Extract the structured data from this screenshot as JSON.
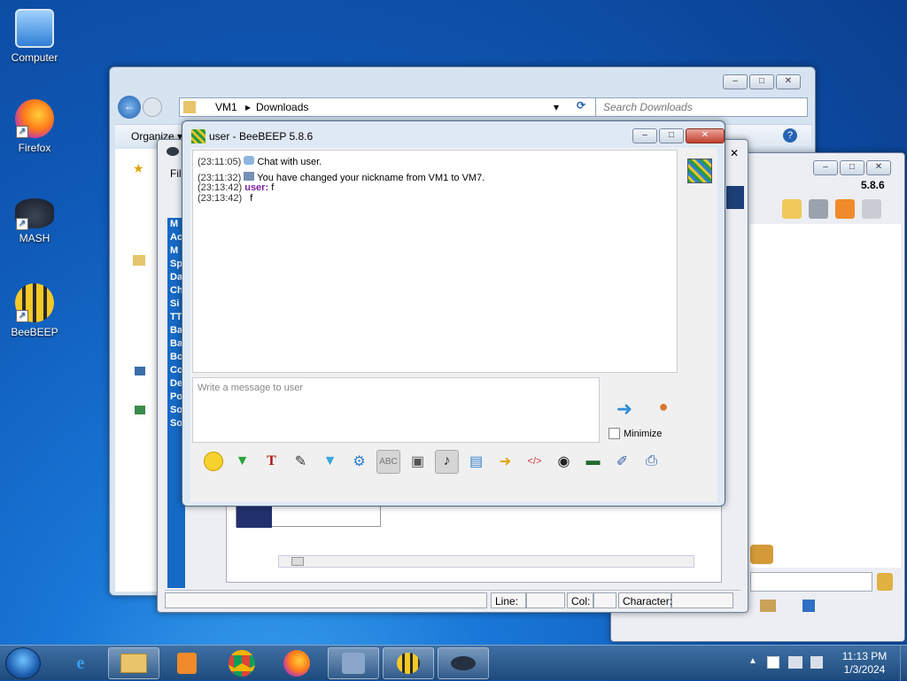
{
  "desktop": {
    "icons": [
      {
        "label": "Computer",
        "icon": "computer-icon"
      },
      {
        "label": "Firefox",
        "icon": "firefox-icon"
      },
      {
        "label": "MASH",
        "icon": "ufo-icon"
      },
      {
        "label": "BeeBEEP",
        "icon": "bee-icon"
      }
    ]
  },
  "explorer": {
    "breadcrumb": [
      "VM1",
      "Downloads"
    ],
    "search_placeholder": "Search Downloads",
    "organize_label": "Organize ▾"
  },
  "mash": {
    "status": {
      "line_label": "Line:",
      "col_label": "Col:",
      "char_label": "Character:"
    },
    "list_items": [
      "M",
      "Ac",
      "M",
      "Sp",
      "Da",
      "Ch",
      "Si",
      "TT",
      "Ba",
      "Ba",
      "Bo",
      "Co",
      "De",
      "Po",
      "So",
      "So"
    ]
  },
  "beebeep_main": {
    "version": "5.8.6"
  },
  "chat": {
    "title": "user - BeeBEEP 5.8.6",
    "history": [
      {
        "time": "(23:11:05)",
        "icon": "chat-bubble-icon",
        "user": "",
        "text": "Chat with user."
      },
      {
        "time": "(23:11:32)",
        "icon": "system-icon",
        "user": "",
        "text": "You have changed your nickname from VM1 to VM7."
      },
      {
        "time": "(23:13:42)",
        "icon": "",
        "user": "user:",
        "text": "f"
      },
      {
        "time": "(23:13:42)",
        "icon": "",
        "user": "",
        "text": "f"
      }
    ],
    "input_placeholder": "Write a message to user",
    "minimize_label": "Minimize",
    "minimize_checked": false,
    "toolbar_icons": [
      "emoji-icon",
      "sticker-icon",
      "font-icon",
      "color-picker-icon",
      "filter-icon",
      "settings-icon",
      "spellcheck-icon",
      "text-mode-icon",
      "note-icon",
      "save-chat-icon",
      "send-file-icon",
      "code-icon",
      "screenshot-icon",
      "voice-record-icon",
      "edit-icon",
      "print-icon"
    ]
  },
  "taskbar": {
    "apps": [
      "ie-icon",
      "explorer-icon",
      "media-player-icon",
      "chrome-icon",
      "firefox-icon",
      "network-app-icon",
      "beebeep-icon",
      "mash-icon"
    ],
    "time": "11:13 PM",
    "date": "1/3/2024"
  }
}
